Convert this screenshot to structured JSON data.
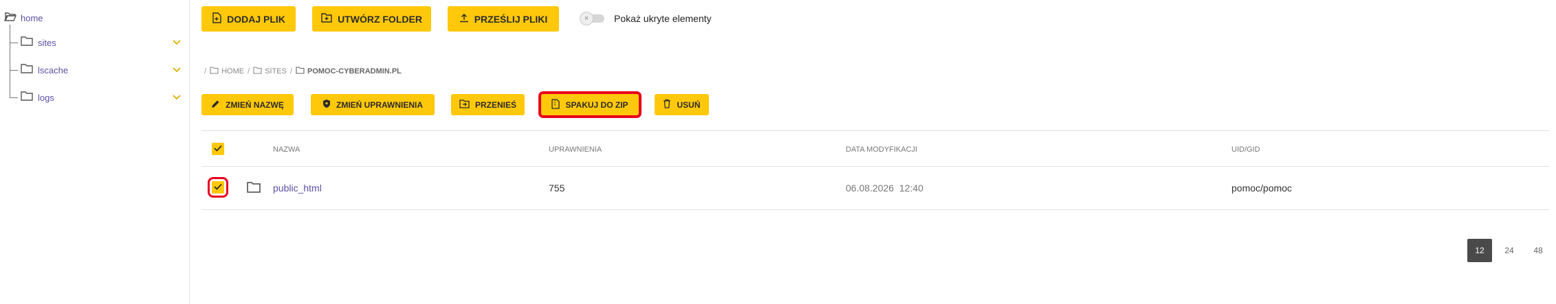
{
  "sidebar": {
    "root": {
      "label": "home"
    },
    "items": [
      {
        "label": "sites"
      },
      {
        "label": "lscache"
      },
      {
        "label": "logs"
      }
    ]
  },
  "toolbar": {
    "add_file": "DODAJ PLIK",
    "create_folder": "UTWÓRZ FOLDER",
    "upload_files": "PRZEŚLIJ PLIKI",
    "show_hidden_label": "Pokaż ukryte elementy"
  },
  "breadcrumb": {
    "items": [
      "HOME",
      "SITES",
      "POMOC-CYBERADMIN.PL"
    ]
  },
  "actions": {
    "rename": "ZMIEŃ NAZWĘ",
    "change_permissions": "ZMIEŃ UPRAWNIENIA",
    "move": "PRZENIEŚ",
    "zip": "SPAKUJ DO ZIP",
    "delete": "USUŃ"
  },
  "table": {
    "columns": {
      "name": "NAZWA",
      "permissions": "UPRAWNIENIA",
      "modified": "DATA MODYFIKACJI",
      "uidgid": "UID/GID"
    },
    "rows": [
      {
        "name": "public_html",
        "permissions": "755",
        "date": "06.08.2026",
        "time": "12:40",
        "uidgid": "pomoc/pomoc"
      }
    ]
  },
  "pagination": {
    "options": [
      "12",
      "24",
      "48"
    ],
    "selected": "12"
  },
  "colors": {
    "accent": "#ffc80a",
    "highlight": "#e8001c",
    "link": "#5b4fa3"
  }
}
